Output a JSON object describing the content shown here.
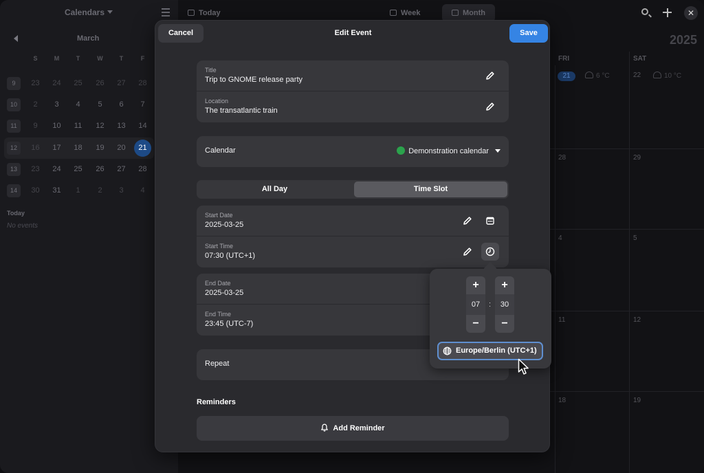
{
  "background": {
    "sidebar": {
      "title": "Calendars",
      "month": "March",
      "weekdays": [
        "S",
        "M",
        "T",
        "W",
        "T",
        "F"
      ],
      "weeks": [
        {
          "num": "9",
          "days": [
            "23",
            "24",
            "25",
            "26",
            "27",
            "28"
          ]
        },
        {
          "num": "10",
          "days": [
            "2",
            "3",
            "4",
            "5",
            "6",
            "7"
          ]
        },
        {
          "num": "11",
          "days": [
            "9",
            "10",
            "11",
            "12",
            "13",
            "14"
          ]
        },
        {
          "num": "12",
          "days": [
            "16",
            "17",
            "18",
            "19",
            "20",
            "21"
          ]
        },
        {
          "num": "13",
          "days": [
            "23",
            "24",
            "25",
            "26",
            "27",
            "28"
          ]
        },
        {
          "num": "14",
          "days": [
            "30",
            "31",
            "1",
            "2",
            "3",
            "4"
          ]
        }
      ],
      "today_label": "Today",
      "no_events": "No events"
    },
    "topbar": {
      "today": "Today",
      "week": "Week",
      "month": "Month"
    },
    "year": "2025",
    "day_headers": [
      "FRI",
      "SAT"
    ],
    "cells": {
      "fri": [
        "21",
        "28",
        "4",
        "11",
        "18"
      ],
      "sat": [
        "22",
        "29",
        "5",
        "12",
        "19"
      ]
    },
    "weather": {
      "fri": "6 °C",
      "sat": "10 °C"
    }
  },
  "dialog": {
    "title": "Edit Event",
    "cancel": "Cancel",
    "save": "Save",
    "title_field": {
      "label": "Title",
      "value": "Trip to GNOME release party"
    },
    "location_field": {
      "label": "Location",
      "value": "The transatlantic train"
    },
    "calendar": {
      "label": "Calendar",
      "value": "Demonstration calendar",
      "color": "#2ba24c"
    },
    "mode": {
      "all_day": "All Day",
      "time_slot": "Time Slot",
      "selected": "time_slot"
    },
    "start_date": {
      "label": "Start Date",
      "value": "2025-03-25"
    },
    "start_time": {
      "label": "Start Time",
      "value": "07:30 (UTC+1)"
    },
    "end_date": {
      "label": "End Date",
      "value": "2025-03-25"
    },
    "end_time": {
      "label": "End Time",
      "value": "23:45 (UTC-7)"
    },
    "repeat": {
      "label": "Repeat"
    },
    "reminders": {
      "heading": "Reminders",
      "add": "Add Reminder"
    }
  },
  "time_popover": {
    "hour": "07",
    "minute": "30",
    "separator": ":",
    "plus": "+",
    "minus": "−",
    "timezone": "Europe/Berlin (UTC+1)"
  },
  "colors": {
    "accent": "#3584e4",
    "focus_ring": "#5f8fd0",
    "today_bg": "#1d4a86"
  }
}
